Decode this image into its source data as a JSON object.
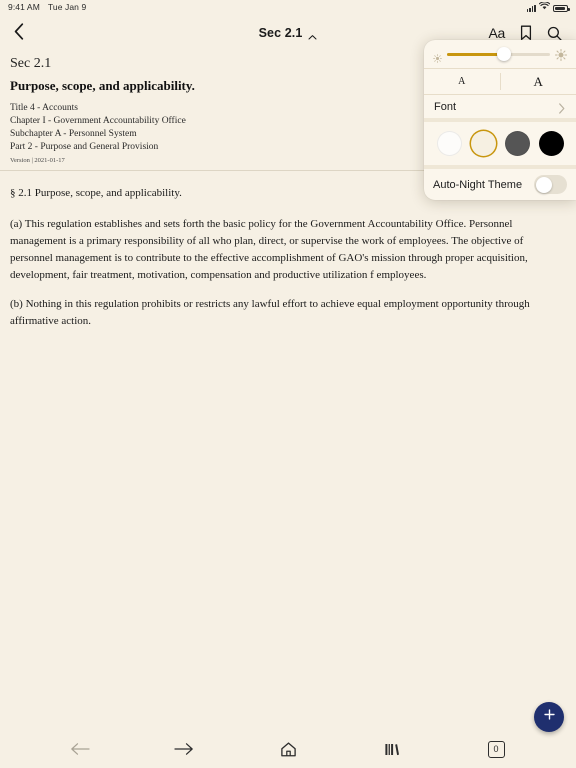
{
  "status_bar": {
    "time": "9:41 AM",
    "date": "Tue Jan 9",
    "icons": [
      "cellular-signal-icon",
      "wifi-icon",
      "battery-icon"
    ]
  },
  "nav_bar": {
    "back_icon": "chevron-left-icon",
    "title": "Sec 2.1",
    "title_chevron_icon": "chevron-up-icon",
    "text_size_label": "Aa",
    "bookmark_icon": "bookmark-icon",
    "search_icon": "search-icon"
  },
  "document": {
    "section_number": "Sec 2.1",
    "title": "Purpose, scope, and applicability.",
    "breadcrumbs": [
      "Title 4 - Accounts",
      "Chapter I - Government Accountability Office",
      "Subchapter A - Personnel System",
      "Part 2 - Purpose and General Provision"
    ],
    "version": "Version | 2021-01-17",
    "paragraphs": [
      "§ 2.1 Purpose, scope, and applicability.",
      "(a) This regulation establishes and sets forth the basic policy for the Government Accountability Office. Personnel management is a primary responsibility of all who plan, direct, or supervise the work of employees. The objective of personnel management is to contribute to the effective accomplishment of GAO's mission through proper acquisition, development, fair treatment, motivation, compensation and productive utilization f employees.",
      "(b) Nothing in this regulation prohibits or restricts any lawful effort to achieve equal employment opportunity through affirmative action."
    ]
  },
  "popover": {
    "brightness": {
      "low_icon": "sun-small-icon",
      "high_icon": "sun-large-icon",
      "value_percent": 55
    },
    "text_size": {
      "decrease_label": "A",
      "increase_label": "A"
    },
    "font_row": {
      "label": "Font",
      "chevron_icon": "chevron-right-icon"
    },
    "themes": [
      {
        "name": "white",
        "color": "#fdfcfa",
        "selected": false
      },
      {
        "name": "sepia",
        "color": "#f6f0e2",
        "selected": true
      },
      {
        "name": "gray",
        "color": "#555555",
        "selected": false
      },
      {
        "name": "black",
        "color": "#000000",
        "selected": false
      }
    ],
    "auto_night": {
      "label": "Auto-Night Theme",
      "enabled": false
    },
    "accent_color": "#c8960f"
  },
  "fab": {
    "icon": "plus-icon",
    "color": "#1f2f6e"
  },
  "toolbar": {
    "items": [
      {
        "name": "back-arrow-icon",
        "enabled": false
      },
      {
        "name": "forward-arrow-icon",
        "enabled": true
      },
      {
        "name": "home-icon",
        "enabled": true
      },
      {
        "name": "library-icon",
        "enabled": true
      },
      {
        "name": "tab-count",
        "label": "0",
        "enabled": true
      }
    ]
  }
}
